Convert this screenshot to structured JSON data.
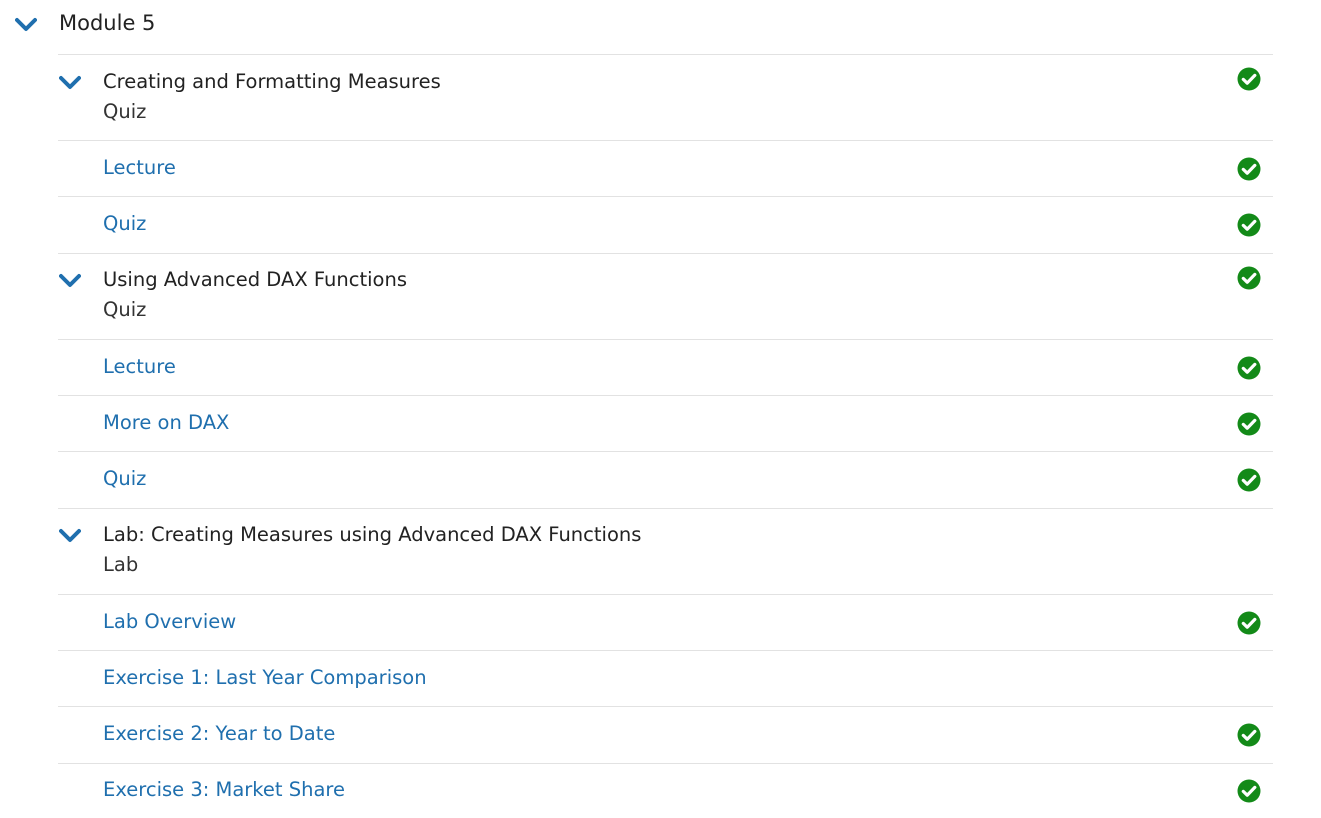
{
  "module": {
    "title": "Module 5"
  },
  "sections": [
    {
      "title": "Creating and Formatting Measures",
      "subtitle": "Quiz",
      "completed": true,
      "items": [
        {
          "label": "Lecture",
          "completed": true
        },
        {
          "label": "Quiz",
          "completed": true
        }
      ]
    },
    {
      "title": "Using Advanced DAX Functions",
      "subtitle": "Quiz",
      "completed": true,
      "items": [
        {
          "label": "Lecture",
          "completed": true
        },
        {
          "label": "More on DAX",
          "completed": true
        },
        {
          "label": "Quiz",
          "completed": true
        }
      ]
    },
    {
      "title": "Lab: Creating Measures using Advanced DAX Functions",
      "subtitle": "Lab",
      "completed": false,
      "items": [
        {
          "label": "Lab Overview",
          "completed": true
        },
        {
          "label": "Exercise 1: Last Year Comparison",
          "completed": false
        },
        {
          "label": "Exercise 2: Year to Date",
          "completed": true
        },
        {
          "label": "Exercise 3: Market Share",
          "completed": true
        }
      ]
    }
  ],
  "icons": {
    "expand": "chevron-down-icon",
    "complete": "check-circle-icon"
  },
  "colors": {
    "accent": "#1f6fae",
    "success": "#138a18",
    "divider": "#e2e2e2",
    "text": "#222222"
  }
}
